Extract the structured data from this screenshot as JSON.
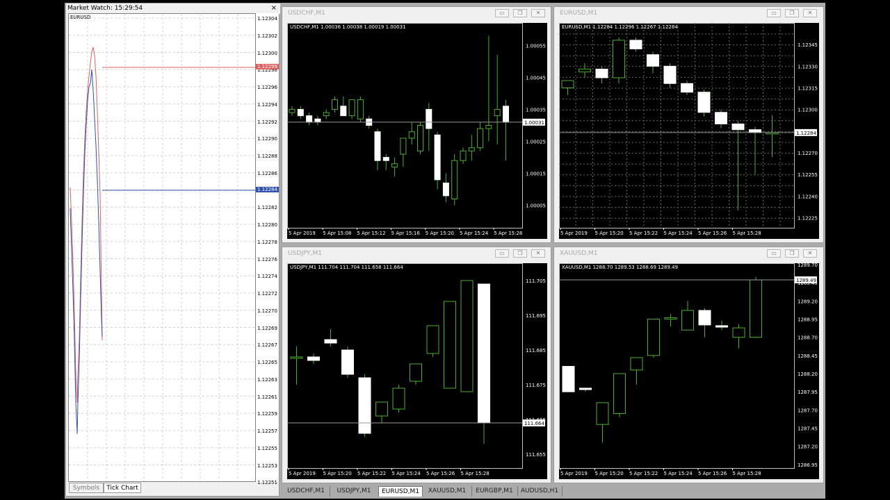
{
  "market_watch": {
    "title": "Market Watch: 15:29:54",
    "close": "×",
    "symbol": "EURUSD",
    "ask_label": "1.12298",
    "bid_label": "1.12284",
    "price_labels": [
      "1.12304",
      "1.12302",
      "1.12300",
      "1.12298",
      "1.12296",
      "1.12294",
      "1.12292",
      "1.12290",
      "1.12288",
      "1.12286",
      "1.12284",
      "1.12282",
      "1.12280",
      "1.12278",
      "1.12276",
      "1.12274",
      "1.12272",
      "1.12270",
      "1.12269",
      "1.12267",
      "1.12265",
      "1.12263",
      "1.12261",
      "1.12259",
      "1.12257",
      "1.12255",
      "1.12253",
      "1.12251"
    ],
    "tabs": [
      "Symbols",
      "Tick Chart"
    ],
    "colors": {
      "ask": "#e06060",
      "bid": "#3050b0"
    }
  },
  "windows": [
    {
      "id": "usdchf",
      "title": "USDCHF,M1",
      "info": "USDCHF,M1  1.00036 1.00038 1.00019 1.00031",
      "price_labels": [
        "1.00055",
        "1.00045",
        "1.00035",
        "1.00025",
        "1.00015",
        "1.00005"
      ],
      "current_label": "1.00031",
      "time_labels": [
        "5 Apr 2019",
        "5 Apr 15:08",
        "5 Apr 15:12",
        "5 Apr 15:16",
        "5 Apr 15:20",
        "5 Apr 15:24",
        "5 Apr 15:28"
      ],
      "grid": false
    },
    {
      "id": "eurusd",
      "title": "EURUSD,M1",
      "info": "EURUSD,M1  1.12284 1.12296 1.12267 1.12284",
      "price_labels": [
        "1.12345",
        "1.12330",
        "1.12315",
        "1.12300",
        "1.12284",
        "1.12270",
        "1.12255",
        "1.12240",
        "1.12225"
      ],
      "current_label": "1.12284",
      "time_labels": [
        "5 Apr 2019",
        "5 Apr 15:20",
        "5 Apr 15:22",
        "5 Apr 15:24",
        "5 Apr 15:26",
        "5 Apr 15:28"
      ],
      "grid": true
    },
    {
      "id": "usdjpy",
      "title": "USDJPY,M1",
      "info": "USDJPY,M1  111.704 111.704 111.658 111.664",
      "price_labels": [
        "111.705",
        "111.695",
        "111.685",
        "111.675",
        "111.665",
        "111.655"
      ],
      "current_label": "111.664",
      "time_labels": [
        "5 Apr 2019",
        "5 Apr 15:20",
        "5 Apr 15:22",
        "5 Apr 15:24",
        "5 Apr 15:26",
        "5 Apr 15:28"
      ],
      "grid": false
    },
    {
      "id": "xauusd",
      "title": "XAUUSD,M1",
      "info": "XAUUSD,M1  1288.70 1289.53 1288.69 1289.49",
      "price_labels": [
        "1289.70",
        "1289.45",
        "1289.20",
        "1288.95",
        "1288.70",
        "1288.45",
        "1288.20",
        "1287.95",
        "1287.70",
        "1287.45",
        "1287.20",
        "1286.95"
      ],
      "current_label": "1289.49",
      "time_labels": [
        "5 Apr 2019",
        "5 Apr 15:20",
        "5 Apr 15:22",
        "5 Apr 15:24",
        "5 Apr 15:26",
        "5 Apr 15:28"
      ],
      "grid": false
    }
  ],
  "window_buttons": {
    "minimize": "▭",
    "restore": "❐",
    "close": "✕"
  },
  "bottom_tabs": [
    {
      "label": "USDCHF,M1",
      "active": false
    },
    {
      "label": "USDJPY,M1",
      "active": false
    },
    {
      "label": "EURUSD,M1",
      "active": true
    },
    {
      "label": "XAUUSD,M1",
      "active": false
    },
    {
      "label": "EURGBP,M1",
      "active": false
    },
    {
      "label": "AUDUSD,H1",
      "active": false
    }
  ],
  "chart_data": [
    {
      "type": "candlestick",
      "symbol": "USDCHF",
      "timeframe": "M1",
      "last": 1.00031,
      "ohlc": [
        [
          1.00034,
          1.00036,
          1.00033,
          1.00035
        ],
        [
          1.00035,
          1.00036,
          1.00032,
          1.00033
        ],
        [
          1.00033,
          1.00034,
          1.0003,
          1.00031
        ],
        [
          1.00032,
          1.00033,
          1.0003,
          1.00031
        ],
        [
          1.00033,
          1.00035,
          1.00032,
          1.00034
        ],
        [
          1.00035,
          1.00039,
          1.00034,
          1.00038
        ],
        [
          1.00036,
          1.00039,
          1.00033,
          1.00033
        ],
        [
          1.00033,
          1.00038,
          1.00032,
          1.00038
        ],
        [
          1.00032,
          1.00039,
          1.00031,
          1.00038
        ],
        [
          1.00032,
          1.00033,
          1.00029,
          1.0003
        ],
        [
          1.00028,
          1.00029,
          1.00016,
          1.00019
        ],
        [
          1.0002,
          1.00021,
          1.00016,
          1.00019
        ],
        [
          1.00017,
          1.0002,
          1.00014,
          1.00018
        ],
        [
          1.00021,
          1.00026,
          1.00017,
          1.00026
        ],
        [
          1.00026,
          1.00031,
          1.00024,
          1.00028
        ],
        [
          1.00022,
          1.00031,
          1.00021,
          1.0003
        ],
        [
          1.00035,
          1.00037,
          1.00022,
          1.00029
        ],
        [
          1.00027,
          1.00028,
          1.0001,
          1.00013
        ],
        [
          1.00012,
          1.00015,
          1.00006,
          1.00008
        ],
        [
          1.00007,
          1.00021,
          1.00005,
          1.00019
        ],
        [
          1.00019,
          1.00023,
          1.00018,
          1.00022
        ],
        [
          1.00022,
          1.00027,
          1.00019,
          1.00023
        ],
        [
          1.00023,
          1.00031,
          1.00022,
          1.00029
        ],
        [
          1.00029,
          1.00058,
          1.00025,
          1.0003
        ],
        [
          1.00033,
          1.00052,
          1.00024,
          1.00035
        ],
        [
          1.00036,
          1.00038,
          1.00019,
          1.00031
        ]
      ]
    },
    {
      "type": "candlestick",
      "symbol": "EURUSD",
      "timeframe": "M1",
      "last": 1.12284,
      "ohlc": [
        [
          1.12315,
          1.1232,
          1.1231,
          1.1232
        ],
        [
          1.12326,
          1.12332,
          1.12322,
          1.12328
        ],
        [
          1.12328,
          1.1233,
          1.12318,
          1.12322
        ],
        [
          1.12322,
          1.1235,
          1.12318,
          1.12348
        ],
        [
          1.12348,
          1.1235,
          1.1234,
          1.12342
        ],
        [
          1.12338,
          1.1234,
          1.12325,
          1.1233
        ],
        [
          1.1233,
          1.12332,
          1.12315,
          1.12318
        ],
        [
          1.12318,
          1.1232,
          1.1231,
          1.12312
        ],
        [
          1.12312,
          1.12314,
          1.12295,
          1.12298
        ],
        [
          1.12298,
          1.123,
          1.12287,
          1.1229
        ],
        [
          1.1229,
          1.12292,
          1.1223,
          1.12286
        ],
        [
          1.12286,
          1.12288,
          1.12255,
          1.12284
        ],
        [
          1.12284,
          1.12296,
          1.12267,
          1.12284
        ]
      ]
    },
    {
      "type": "candlestick",
      "symbol": "USDJPY",
      "timeframe": "M1",
      "last": 111.664,
      "ohlc": [
        [
          111.683,
          111.686,
          111.675,
          111.683
        ],
        [
          111.683,
          111.684,
          111.681,
          111.682
        ],
        [
          111.688,
          111.691,
          111.686,
          111.687
        ],
        [
          111.685,
          111.686,
          111.677,
          111.678
        ],
        [
          111.677,
          111.678,
          111.66,
          111.661
        ],
        [
          111.666,
          111.67,
          111.664,
          111.67
        ],
        [
          111.668,
          111.675,
          111.667,
          111.674
        ],
        [
          111.676,
          111.679,
          111.675,
          111.681
        ],
        [
          111.684,
          111.692,
          111.683,
          111.692
        ],
        [
          111.674,
          111.699,
          111.674,
          111.699
        ],
        [
          111.673,
          111.705,
          111.673,
          111.705
        ],
        [
          111.704,
          111.704,
          111.658,
          111.664
        ]
      ]
    },
    {
      "type": "candlestick",
      "symbol": "XAUUSD",
      "timeframe": "M1",
      "last": 1289.49,
      "ohlc": [
        [
          1288.3,
          1288.3,
          1287.95,
          1287.95
        ],
        [
          1288.0,
          1288.0,
          1287.95,
          1287.98
        ],
        [
          1287.5,
          1287.62,
          1287.25,
          1287.8
        ],
        [
          1287.65,
          1288.2,
          1287.6,
          1288.2
        ],
        [
          1288.25,
          1288.42,
          1288.05,
          1288.42
        ],
        [
          1288.45,
          1288.95,
          1288.42,
          1288.95
        ],
        [
          1288.95,
          1289.02,
          1288.85,
          1288.97
        ],
        [
          1288.8,
          1289.2,
          1288.8,
          1289.07
        ],
        [
          1289.07,
          1289.1,
          1288.7,
          1288.87
        ],
        [
          1288.86,
          1288.93,
          1288.8,
          1288.84
        ],
        [
          1288.7,
          1288.88,
          1288.55,
          1288.83
        ],
        [
          1288.7,
          1289.53,
          1288.69,
          1289.49
        ]
      ]
    }
  ]
}
